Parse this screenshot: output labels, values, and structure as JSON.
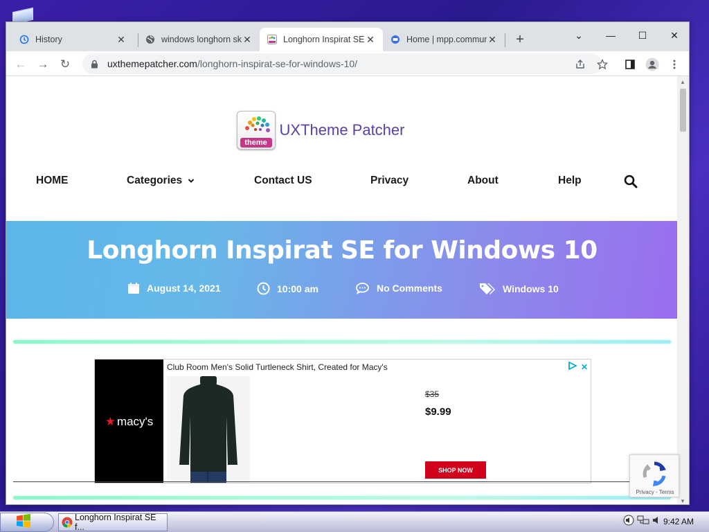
{
  "window": {
    "tabs": [
      {
        "label": "History",
        "icon": "history-icon",
        "close": "✕"
      },
      {
        "label": "windows longhorn sk",
        "icon": "globe-icon",
        "close": "✕"
      },
      {
        "label": "Longhorn Inspirat SE",
        "icon": "site-favicon",
        "close": "✕",
        "active": true
      },
      {
        "label": "Home | mpp.commun",
        "icon": "forum-favicon",
        "close": "✕"
      }
    ],
    "new_tab": "+",
    "controls": {
      "tab_search": "⌄",
      "minimize": "—",
      "maximize": "☐",
      "close": "✕"
    }
  },
  "toolbar": {
    "back": "←",
    "forward": "→",
    "reload": "↻",
    "url_domain": "uxthemepatcher.com",
    "url_path": "/longhorn-inspirat-se-for-windows-10/"
  },
  "site": {
    "logo_badge": "theme",
    "name": "UXTheme Patcher",
    "nav": [
      {
        "label": "HOME"
      },
      {
        "label": "Categories",
        "caret": "⌄"
      },
      {
        "label": "Contact US"
      },
      {
        "label": "Privacy"
      },
      {
        "label": "About"
      },
      {
        "label": "Help"
      }
    ]
  },
  "post": {
    "title": "Longhorn Inspirat SE for Windows 10",
    "date": "August 14, 2021",
    "time": "10:00 am",
    "comments": "No Comments",
    "category": "Windows 10"
  },
  "ad": {
    "brand": "macy's",
    "brand_star": "★",
    "title": "Club Room Men's Solid Turtleneck Shirt, Created for Macy's",
    "price_old": "$35",
    "price_new": "$9.99",
    "cta": "SHOP NOW",
    "close": "✕"
  },
  "recaptcha": {
    "links": "Privacy - Terms"
  },
  "taskbar": {
    "task_label": "Longhorn Inspirat SE f...",
    "clock": "9:42 AM"
  },
  "colors": {
    "hero_start": "#5bb6ea",
    "hero_end": "#9a6df0",
    "logo_text": "#5b3fa6",
    "shop_button": "#d0021b"
  }
}
